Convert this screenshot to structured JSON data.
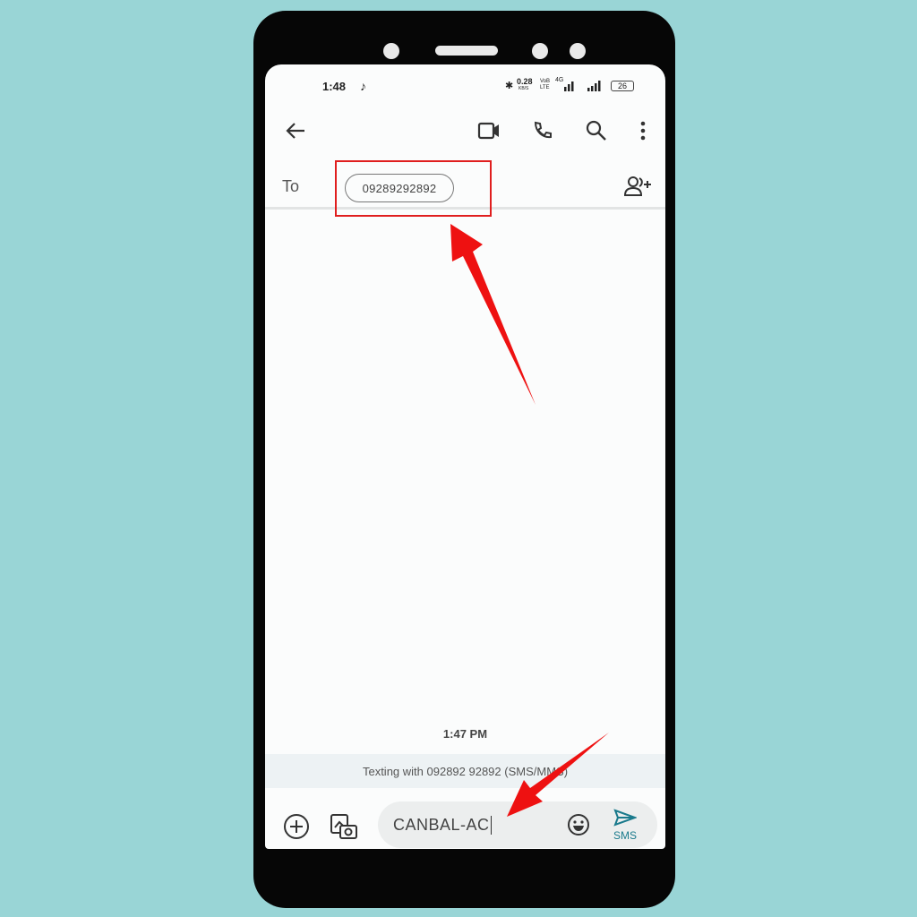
{
  "status_bar": {
    "time": "1:48",
    "net_speed": "0.28",
    "net_unit": "KB/S",
    "volte": "VoB LTE",
    "net_type": "4G",
    "battery": "26"
  },
  "toolbar": {
    "back": "arrow-left-icon",
    "video": "video-call-icon",
    "call": "phone-icon",
    "search": "search-icon",
    "more": "more-vert-icon"
  },
  "recipient": {
    "label": "To",
    "chip": "09289292892"
  },
  "thread": {
    "timestamp": "1:47 PM",
    "banner": "Texting with 092892 92892 (SMS/MMS)"
  },
  "compose": {
    "text": "CANBAL-AC",
    "send_label": "SMS"
  },
  "colors": {
    "background": "#99d5d6",
    "annotation": "#e01e1e",
    "send": "#1a7a8c"
  }
}
